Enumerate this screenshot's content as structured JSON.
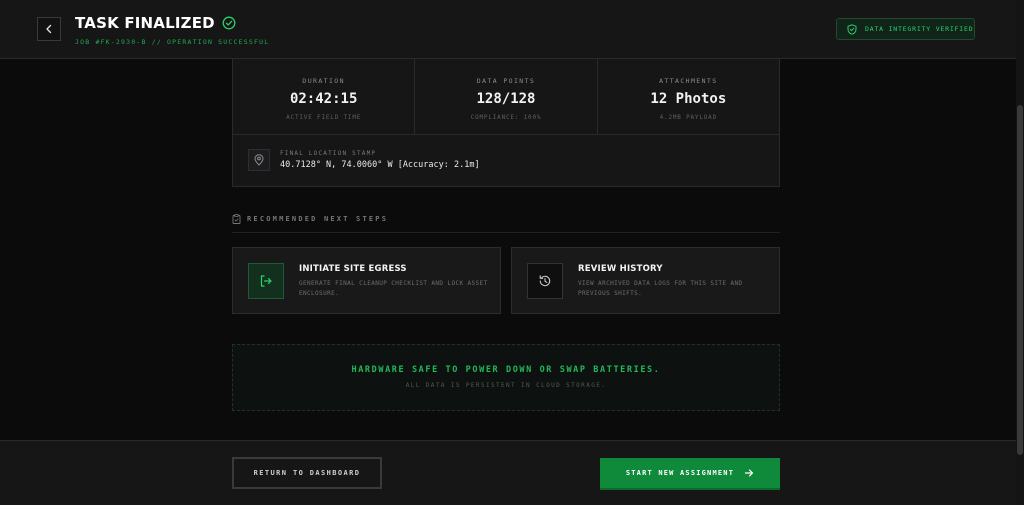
{
  "header": {
    "title": "TASK FINALIZED",
    "subtitle": "JOB #FK-2930-B // OPERATION SUCCESSFUL",
    "badge": "DATA INTEGRITY VERIFIED"
  },
  "stats": [
    {
      "label": "DURATION",
      "value": "02:42:15",
      "sub": "ACTIVE FIELD TIME"
    },
    {
      "label": "DATA POINTS",
      "value": "128/128",
      "sub": "COMPLIANCE: 100%"
    },
    {
      "label": "ATTACHMENTS",
      "value": "12 Photos",
      "sub": "4.2MB PAYLOAD"
    }
  ],
  "location": {
    "label": "FINAL LOCATION STAMP",
    "value": "40.7128° N, 74.0060° W [Accuracy: 2.1m]"
  },
  "next_steps": {
    "title": "RECOMMENDED NEXT STEPS",
    "items": [
      {
        "title": "INITIATE SITE EGRESS",
        "desc": "GENERATE FINAL CLEANUP CHECKLIST AND LOCK ASSET ENCLOSURE."
      },
      {
        "title": "REVIEW HISTORY",
        "desc": "VIEW ARCHIVED DATA LOGS FOR THIS SITE AND PREVIOUS SHIFTS."
      }
    ]
  },
  "power": {
    "main": "HARDWARE SAFE TO POWER DOWN OR SWAP BATTERIES.",
    "sub": "ALL DATA IS PERSISTENT IN CLOUD STORAGE."
  },
  "footer": {
    "return_label": "RETURN TO DASHBOARD",
    "start_label": "START NEW ASSIGNMENT"
  },
  "colors": {
    "accent": "#22b85a",
    "primary_button": "#0f8a3a",
    "background": "#0b0b0c",
    "surface": "#161617"
  },
  "icons": {
    "back": "chevron-left-icon",
    "title_status": "check-circle-icon",
    "badge": "shield-check-icon",
    "location": "map-pin-icon",
    "section": "clipboard-icon",
    "egress": "exit-icon",
    "history": "history-icon",
    "start": "arrow-right-icon"
  }
}
